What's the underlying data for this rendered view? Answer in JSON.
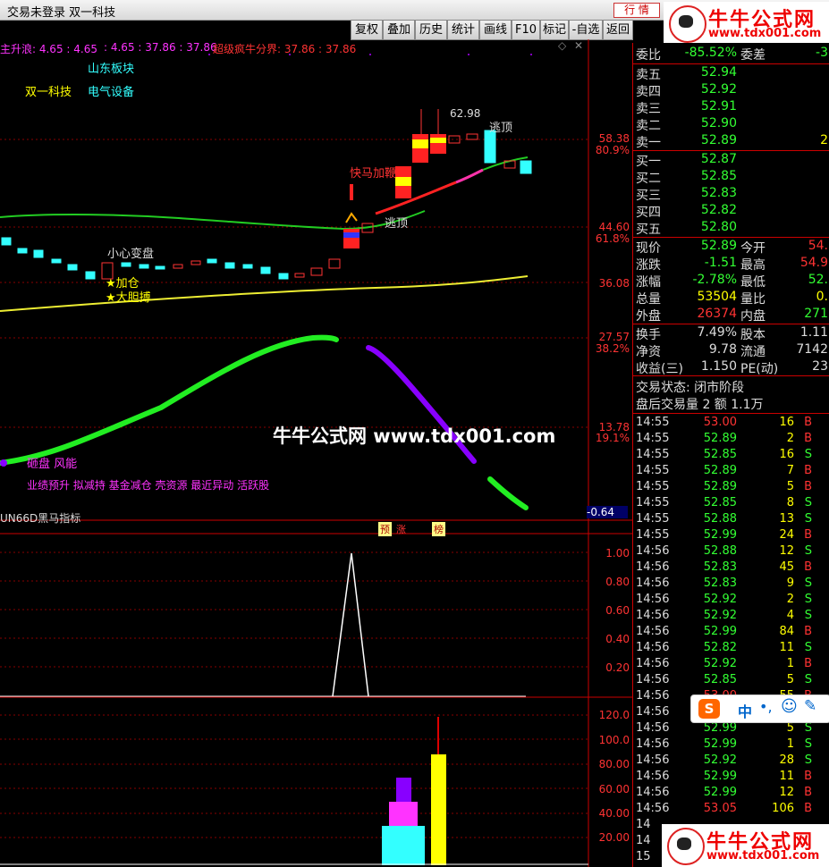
{
  "window": {
    "title": "交易未登录  双一科技",
    "quote_button": "行  情"
  },
  "watermark": {
    "name": "牛牛公式网",
    "url": "www.tdx001.com"
  },
  "center_watermark": "牛牛公式网 www.tdx001.com",
  "toolbar": [
    "复权",
    "叠加",
    "历史",
    "统计",
    "画线",
    "F10",
    "标记",
    "-自选",
    "返回"
  ],
  "main_chart": {
    "indicator_line": [
      {
        "text": "主升浪: 4.65 : 4.65",
        "color": "#ff33ff"
      },
      {
        "text": ": 4.65 : 37.86 : 37.86",
        "color": "#ff33ff"
      },
      {
        "text": "超级疯牛分界: 37.86 : 37.86",
        "color": "#ff3333"
      }
    ],
    "sector": "山东板块",
    "stock_name": "双一科技",
    "industry": "电气设备",
    "price_ticks": [
      {
        "v": "58.38",
        "c": "#f33"
      },
      {
        "v": "80.9%",
        "c": "#f33"
      },
      {
        "v": "44.60",
        "c": "#f33"
      },
      {
        "v": "61.8%",
        "c": "#f33"
      },
      {
        "v": "36.08",
        "c": "#f33"
      },
      {
        "v": "27.57",
        "c": "#f33"
      },
      {
        "v": "38.2%",
        "c": "#f33"
      },
      {
        "v": "13.78",
        "c": "#f33"
      },
      {
        "v": "19.1%",
        "c": "#f33"
      },
      {
        "v": "-0.64",
        "c": "#fff"
      }
    ],
    "annotations": {
      "high": "62.98",
      "escape_top_1": "逃顶",
      "escape_top_2": "逃顶",
      "fast_horse": "快马加鞭",
      "careful": "小心变盘",
      "add_position": "★加仓",
      "bold_buy": "★大胆搏",
      "cost_line": "砸盘 风能",
      "tags": "业绩预升 拟减持 基金减仓 壳资源 最近异动 活跃股",
      "indicator_name": "UN66D黑马指标",
      "flag_1": "预",
      "flag_2": "涨",
      "flag_3": "榜"
    }
  },
  "sub1_ticks": [
    "1.00",
    "0.80",
    "0.60",
    "0.40",
    "0.20"
  ],
  "sub2_ticks": [
    "120.0",
    "100.0",
    "80.00",
    "60.00",
    "40.00",
    "20.00"
  ],
  "orderbook": {
    "weibi": {
      "label": "委比",
      "value": "-85.52%",
      "label2": "委差",
      "value2": "-3"
    },
    "sell": [
      {
        "label": "卖五",
        "price": "52.94",
        "vol": ""
      },
      {
        "label": "卖四",
        "price": "52.92",
        "vol": ""
      },
      {
        "label": "卖三",
        "price": "52.91",
        "vol": ""
      },
      {
        "label": "卖二",
        "price": "52.90",
        "vol": ""
      },
      {
        "label": "卖一",
        "price": "52.89",
        "vol": "2"
      }
    ],
    "buy": [
      {
        "label": "买一",
        "price": "52.87",
        "vol": ""
      },
      {
        "label": "买二",
        "price": "52.85",
        "vol": ""
      },
      {
        "label": "买三",
        "price": "52.83",
        "vol": ""
      },
      {
        "label": "买四",
        "price": "52.82",
        "vol": ""
      },
      {
        "label": "买五",
        "price": "52.80",
        "vol": ""
      }
    ]
  },
  "quote": [
    {
      "l1": "现价",
      "v1": "52.89",
      "c1": "#3f3",
      "l2": "今开",
      "v2": "54.",
      "c2": "#f33"
    },
    {
      "l1": "涨跌",
      "v1": "-1.51",
      "c1": "#3f3",
      "l2": "最高",
      "v2": "54.9",
      "c2": "#f33"
    },
    {
      "l1": "涨幅",
      "v1": "-2.78%",
      "c1": "#3f3",
      "l2": "最低",
      "v2": "52.",
      "c2": "#3f3"
    },
    {
      "l1": "总量",
      "v1": "53504",
      "c1": "#ff0",
      "l2": "量比",
      "v2": "0.",
      "c2": "#ff0"
    },
    {
      "l1": "外盘",
      "v1": "26374",
      "c1": "#f33",
      "l2": "内盘",
      "v2": "271",
      "c2": "#3f3"
    }
  ],
  "stats": [
    {
      "l1": "换手",
      "v1": "7.49%",
      "l2": "股本",
      "v2": "1.11"
    },
    {
      "l1": "净资",
      "v1": "9.78",
      "l2": "流通",
      "v2": "7142"
    },
    {
      "l1": "收益(三)",
      "v1": "1.150",
      "l2": "PE(动)",
      "v2": "23"
    }
  ],
  "status": {
    "line1": "交易状态: 闭市阶段",
    "line2": "盘后交易量 2 额 1.1万"
  },
  "ticks": [
    {
      "t": "14:55",
      "p": "53.00",
      "pc": "#f33",
      "v": "16",
      "s": "B"
    },
    {
      "t": "14:55",
      "p": "52.89",
      "pc": "#3f3",
      "v": "2",
      "s": "B"
    },
    {
      "t": "14:55",
      "p": "52.85",
      "pc": "#3f3",
      "v": "16",
      "s": "S"
    },
    {
      "t": "14:55",
      "p": "52.89",
      "pc": "#3f3",
      "v": "7",
      "s": "B"
    },
    {
      "t": "14:55",
      "p": "52.89",
      "pc": "#3f3",
      "v": "5",
      "s": "B"
    },
    {
      "t": "14:55",
      "p": "52.85",
      "pc": "#3f3",
      "v": "8",
      "s": "S"
    },
    {
      "t": "14:55",
      "p": "52.88",
      "pc": "#3f3",
      "v": "13",
      "s": "S"
    },
    {
      "t": "14:55",
      "p": "52.99",
      "pc": "#3f3",
      "v": "24",
      "s": "B"
    },
    {
      "t": "14:56",
      "p": "52.88",
      "pc": "#3f3",
      "v": "12",
      "s": "S"
    },
    {
      "t": "14:56",
      "p": "52.83",
      "pc": "#3f3",
      "v": "45",
      "s": "B"
    },
    {
      "t": "14:56",
      "p": "52.83",
      "pc": "#3f3",
      "v": "9",
      "s": "S"
    },
    {
      "t": "14:56",
      "p": "52.92",
      "pc": "#3f3",
      "v": "2",
      "s": "S"
    },
    {
      "t": "14:56",
      "p": "52.92",
      "pc": "#3f3",
      "v": "4",
      "s": "S"
    },
    {
      "t": "14:56",
      "p": "52.99",
      "pc": "#3f3",
      "v": "84",
      "s": "B"
    },
    {
      "t": "14:56",
      "p": "52.82",
      "pc": "#3f3",
      "v": "11",
      "s": "S"
    },
    {
      "t": "14:56",
      "p": "52.92",
      "pc": "#3f3",
      "v": "1",
      "s": "B"
    },
    {
      "t": "14:56",
      "p": "52.85",
      "pc": "#3f3",
      "v": "5",
      "s": "S"
    },
    {
      "t": "14:56",
      "p": "53.00",
      "pc": "#f33",
      "v": "55",
      "s": "B"
    },
    {
      "t": "14:56",
      "p": "",
      "pc": "#3f3",
      "v": "",
      "s": ""
    },
    {
      "t": "14:56",
      "p": "52.99",
      "pc": "#3f3",
      "v": "5",
      "s": "S"
    },
    {
      "t": "14:56",
      "p": "52.99",
      "pc": "#3f3",
      "v": "1",
      "s": "S"
    },
    {
      "t": "14:56",
      "p": "52.92",
      "pc": "#3f3",
      "v": "28",
      "s": "S"
    },
    {
      "t": "14:56",
      "p": "52.99",
      "pc": "#3f3",
      "v": "11",
      "s": "B"
    },
    {
      "t": "14:56",
      "p": "52.99",
      "pc": "#3f3",
      "v": "12",
      "s": "B"
    },
    {
      "t": "14:56",
      "p": "53.05",
      "pc": "#f33",
      "v": "106",
      "s": "B"
    },
    {
      "t": "14",
      "p": "",
      "pc": "#3f3",
      "v": "",
      "s": ""
    },
    {
      "t": "14",
      "p": "",
      "pc": "#3f3",
      "v": "",
      "s": ""
    },
    {
      "t": "15",
      "p": "",
      "pc": "#3f3",
      "v": "",
      "s": ""
    }
  ],
  "ime": {
    "label": "中"
  }
}
